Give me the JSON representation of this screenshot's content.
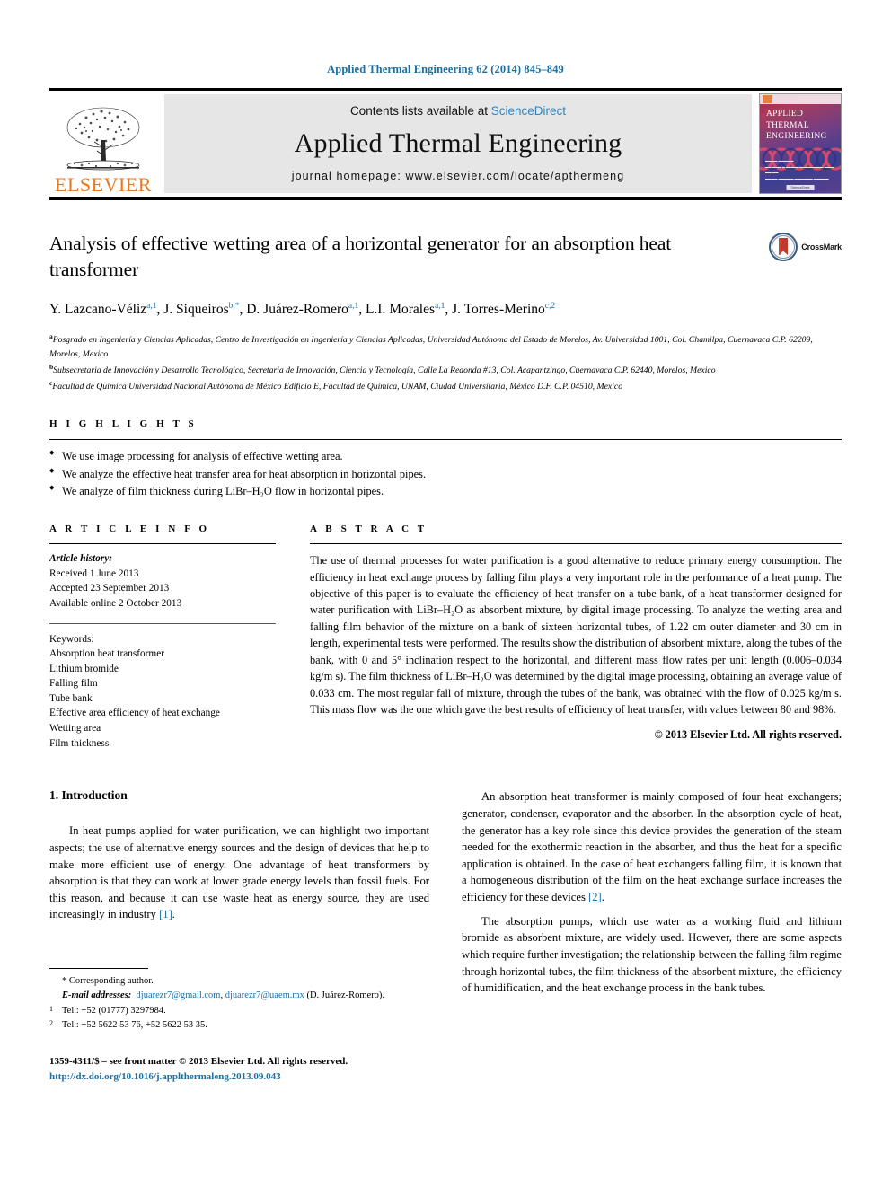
{
  "running_head": "Applied Thermal Engineering 62 (2014) 845–849",
  "masthead": {
    "contents_prefix": "Contents lists available at ",
    "sciencedirect": "ScienceDirect",
    "journal_title": "Applied Thermal Engineering",
    "homepage": "journal homepage: www.elsevier.com/locate/apthermeng",
    "publisher_wordmark": "ELSEVIER",
    "cover": {
      "line1": "APPLIED",
      "line2": "THERMAL",
      "line3": "ENGINEERING",
      "badge": "ScienceDirect"
    },
    "accent_link_color": "#2e86c1",
    "elsevier_orange": "#E87722"
  },
  "article": {
    "title": "Analysis of effective wetting area of a horizontal generator for an absorption heat transformer",
    "crossmark_label": "CrossMark",
    "authors": [
      {
        "name": "Y. Lazcano-Véliz",
        "sup": "a,1",
        "sep": ", "
      },
      {
        "name": "J. Siqueiros",
        "sup": "b,*",
        "sep": ", "
      },
      {
        "name": "D. Juárez-Romero",
        "sup": "a,1",
        "sep": ", "
      },
      {
        "name": "L.I. Morales",
        "sup": "a,1",
        "sep": ", "
      },
      {
        "name": "J. Torres-Merino",
        "sup": "c,2",
        "sep": ""
      }
    ],
    "affiliations": [
      {
        "mark": "a",
        "text": "Posgrado en Ingeniería y Ciencias Aplicadas, Centro de Investigación en Ingeniería y Ciencias Aplicadas, Universidad Autónoma del Estado de Morelos, Av. Universidad 1001, Col. Chamilpa, Cuernavaca C.P. 62209, Morelos, Mexico"
      },
      {
        "mark": "b",
        "text": "Subsecretaria de Innovación y Desarrollo Tecnológico, Secretaria de Innovación, Ciencia y Tecnología, Calle La Redonda #13, Col. Acapantzingo, Cuernavaca C.P. 62440, Morelos, Mexico"
      },
      {
        "mark": "c",
        "text": "Facultad de Química Universidad Nacional Autónoma de México Edificio E, Facultad de Química, UNAM, Ciudad Universitaria, México D.F. C.P. 04510, Mexico"
      }
    ]
  },
  "highlights": {
    "heading": "H I G H L I G H T S",
    "items": [
      "We use image processing for analysis of effective wetting area.",
      "We analyze the effective heat transfer area for heat absorption in horizontal pipes.",
      "We analyze of film thickness during LiBr–H₂O flow in horizontal pipes."
    ]
  },
  "article_info": {
    "heading": "A R T I C L E  I N F O",
    "history_label": "Article history:",
    "history": [
      "Received 1 June 2013",
      "Accepted 23 September 2013",
      "Available online 2 October 2013"
    ],
    "keywords_label": "Keywords:",
    "keywords": [
      "Absorption heat transformer",
      "Lithium bromide",
      "Falling film",
      "Tube bank",
      "Effective area efficiency of heat exchange",
      "Wetting area",
      "Film thickness"
    ]
  },
  "abstract": {
    "heading": "A B S T R A C T",
    "text": "The use of thermal processes for water purification is a good alternative to reduce primary energy consumption. The efficiency in heat exchange process by falling film plays a very important role in the performance of a heat pump. The objective of this paper is to evaluate the efficiency of heat transfer on a tube bank, of a heat transformer designed for water purification with LiBr–H₂O as absorbent mixture, by digital image processing. To analyze the wetting area and falling film behavior of the mixture on a bank of sixteen horizontal tubes, of 1.22 cm outer diameter and 30 cm in length, experimental tests were performed. The results show the distribution of absorbent mixture, along the tubes of the bank, with 0 and 5° inclination respect to the horizontal, and different mass flow rates per unit length (0.006–0.034 kg/m s). The film thickness of LiBr–H₂O was determined by the digital image processing, obtaining an average value of 0.033 cm. The most regular fall of mixture, through the tubes of the bank, was obtained with the flow of 0.025 kg/m s. This mass flow was the one which gave the best results of efficiency of heat transfer, with values between 80 and 98%.",
    "copyright": "© 2013 Elsevier Ltd. All rights reserved."
  },
  "body": {
    "section_number_title": "1. Introduction",
    "left_paragraphs": [
      "In heat pumps applied for water purification, we can highlight two important aspects; the use of alternative energy sources and the design of devices that help to make more efficient use of energy. One advantage of heat transformers by absorption is that they can work at lower grade energy levels than fossil fuels. For this reason, and because it can use waste heat as energy source, they are used increasingly in industry [1]."
    ],
    "left_ref": "[1]",
    "right_paragraphs": [
      "An absorption heat transformer is mainly composed of four heat exchangers; generator, condenser, evaporator and the absorber. In the absorption cycle of heat, the generator has a key role since this device provides the generation of the steam needed for the exothermic reaction in the absorber, and thus the heat for a specific application is obtained. In the case of heat exchangers falling film, it is known that a homogeneous distribution of the film on the heat exchange surface increases the efficiency for these devices [2].",
      "The absorption pumps, which use water as a working fluid and lithium bromide as absorbent mixture, are widely used. However, there are some aspects which require further investigation; the relationship between the falling film regime through horizontal tubes, the film thickness of the absorbent mixture, the efficiency of humidification, and the heat exchange process in the bank tubes."
    ],
    "right_ref": "[2]"
  },
  "footnotes": {
    "corresponding": "* Corresponding author.",
    "email_label": "E-mail addresses:",
    "email1": "djuarezr7@gmail.com",
    "email_sep": ", ",
    "email2": "djuarezr7@uaem.mx",
    "email_owner": " (D. Juárez-Romero).",
    "tel1_mark": "1",
    "tel1": "Tel.: +52 (01777) 3297984.",
    "tel2_mark": "2",
    "tel2": "Tel.: +52 5622 53 76, +52 5622 53 35."
  },
  "imprint": {
    "line1": "1359-4311/$ – see front matter © 2013 Elsevier Ltd. All rights reserved.",
    "doi": "http://dx.doi.org/10.1016/j.applthermaleng.2013.09.043"
  }
}
